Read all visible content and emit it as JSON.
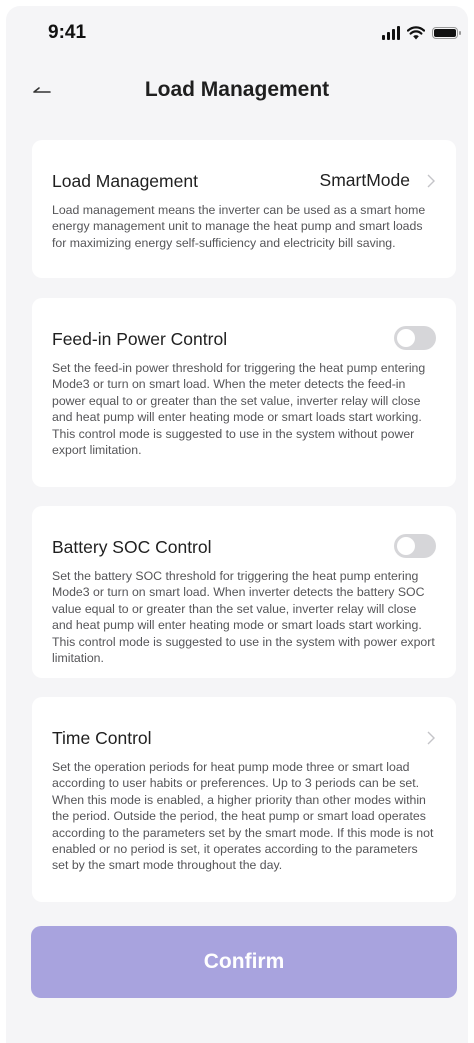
{
  "status_bar": {
    "time": "9:41"
  },
  "header": {
    "title": "Load Management",
    "back_icon": "back-arrow-icon"
  },
  "cards": {
    "load_management": {
      "title": "Load Management",
      "value": "SmartMode",
      "description": "Load management means the inverter can be used as a smart home energy management unit to manage the heat pump and smart loads for maximizing energy self-sufficiency and electricity bill saving."
    },
    "feed_in": {
      "title": "Feed-in Power Control",
      "enabled": false,
      "description": "Set the feed-in power threshold for triggering the heat pump entering Mode3 or turn on smart load. When the meter detects the feed-in power equal to or greater than the set value, inverter relay will close and heat pump will enter heating mode or smart loads start working. This control mode is suggested to use in the system without power export limitation."
    },
    "battery_soc": {
      "title": "Battery SOC Control",
      "enabled": false,
      "description": "Set the battery SOC threshold for triggering the heat pump entering Mode3 or turn on smart load. When inverter detects the battery SOC value equal to or greater than the set value, inverter relay will close and heat pump will enter heating mode or smart loads start working. This control mode is suggested to use in the system with power export limitation."
    },
    "time_control": {
      "title": "Time Control",
      "description": "Set the operation periods for heat pump mode three or smart load according to user habits or preferences. Up to 3 periods can be set. When this mode is enabled, a higher priority than other modes within the period. Outside the period, the heat pump or smart load operates according to the parameters set by the smart mode. If this mode is not enabled or no period is set, it operates according to the parameters set by the smart mode throughout the day."
    }
  },
  "confirm_label": "Confirm",
  "colors": {
    "background": "#f5f5f7",
    "card": "#ffffff",
    "confirm_button": "#a8a3de",
    "toggle_off": "#d6d6d9",
    "text_primary": "#1f1f1f",
    "text_secondary": "#555558"
  }
}
